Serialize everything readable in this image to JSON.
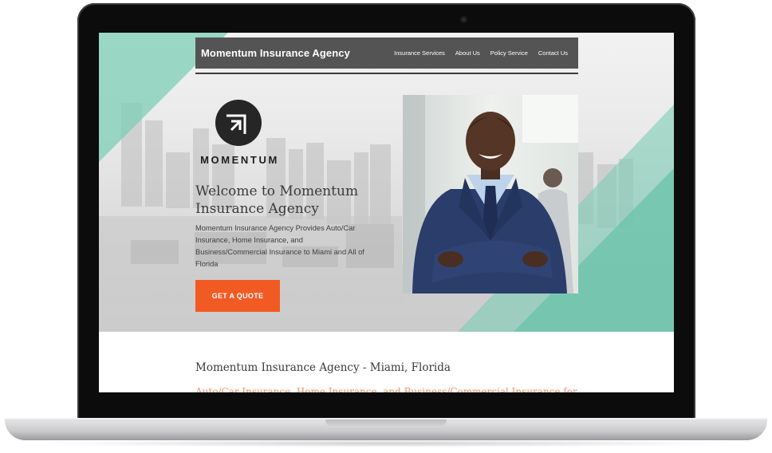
{
  "nav": {
    "brand": "Momentum Insurance Agency",
    "links": [
      "Insurance Services",
      "About Us",
      "Policy Service",
      "Contact Us"
    ]
  },
  "logo": {
    "wordmark": "MOMENTUM",
    "icon": "momentum-arrow-logo-icon"
  },
  "hero": {
    "title": "Welcome to Momentum Insurance Agency",
    "description": "Momentum Insurance Agency Provides Auto/Car Insurance, Home Insurance, and Business/Commercial Insurance to Miami and All of Florida",
    "cta_label": "GET A QUOTE"
  },
  "section": {
    "title": "Momentum Insurance Agency - Miami, Florida",
    "subtitle": "Auto/Car Insurance, Home Insurance, and Business/Commercial Insurance for"
  },
  "colors": {
    "accent_teal": "#7ccdb6",
    "cta_orange": "#f25a24",
    "nav_bg": "#545454",
    "subtitle_orange": "#e8936a"
  }
}
